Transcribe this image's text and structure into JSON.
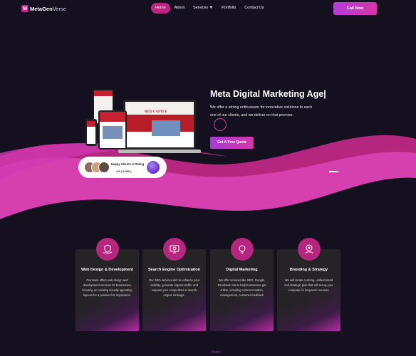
{
  "brand": {
    "mark": "M",
    "name_bold": "MetaGen",
    "name_light": "Verse"
  },
  "nav": {
    "items": [
      {
        "label": "Home",
        "active": true
      },
      {
        "label": "About"
      },
      {
        "label": "Services ▼"
      },
      {
        "label": "Portfolio"
      },
      {
        "label": "Contact Us"
      }
    ],
    "cta_label": "Call Now"
  },
  "hero": {
    "title": "Meta Digital Marketing Age|",
    "text": "We offer a strong enthusiasm for innovative solutions to each one of our clients, and we deliver on that promise.",
    "button_label": "Get A Free Quote",
    "mockup_brand": "RED CASTLE"
  },
  "rating_badge": {
    "label": "Happy Clients & Rating",
    "rating": "4.8 ( 9,090 )"
  },
  "services": [
    {
      "icon": "hand-shield-icon",
      "title": "Web Design & Development",
      "text": "Our team offers web design and development services for businesses, focusing on creating visually appealing layouts for a positive first impression."
    },
    {
      "icon": "seo-icon",
      "title": "Search Engine Optimization",
      "text": "Our SEO services aim to enhance your visibility, generate organic traffic, and surpass your competitors in search engine rankings."
    },
    {
      "icon": "lightbulb-icon",
      "title": "Digital Marketing",
      "text": "We offer services like SEO, Google, Facebook Ads to help businesses get online, including content creation, management, customer feedback"
    },
    {
      "icon": "branding-icon",
      "title": "Branding & Strategy",
      "text": "We will create a strong, unified brand and strategic plan that will set up your company for long-term success."
    }
  ],
  "footer_peek": "Vision",
  "colors": {
    "background": "#14101f",
    "accent": "#b9257f",
    "cta": "#c23cc0"
  }
}
